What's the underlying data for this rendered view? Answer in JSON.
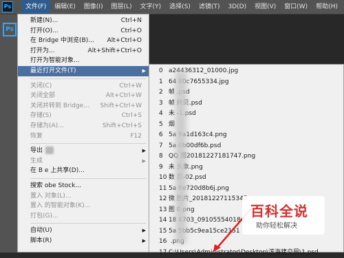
{
  "app": {
    "logo": "Ps"
  },
  "menubar": {
    "items": [
      "文件(F)",
      "编辑(E)",
      "图像(I)",
      "图层(L)",
      "文字(Y)",
      "选择(S)",
      "滤镜(T)",
      "3D(D)",
      "视图(V)",
      "窗口(W)",
      "帮助(H)"
    ]
  },
  "file_menu": {
    "new": "新建(N)...",
    "new_sc": "Ctrl+N",
    "open": "打开(O)...",
    "open_sc": "Ctrl+O",
    "bridge": "在 Bridge 中浏览(B)...",
    "bridge_sc": "Alt+Ctrl+O",
    "open_as": "打开为...",
    "open_as_sc": "Alt+Shift+Ctrl+O",
    "open_smart": "打开为智能对象...",
    "recent": "最近打开文件(T)",
    "close": "关闭(C)",
    "close_sc": "Ctrl+W",
    "close_all": "关闭全部",
    "close_all_sc": "Alt+Ctrl+W",
    "close_bridge": "关闭并转到 Bridge...",
    "close_bridge_sc": "Shift+Ctrl+W",
    "save": "存储(S)",
    "save_sc": "Ctrl+S",
    "save_as": "存储为(A)...",
    "save_as_sc": "Shift+Ctrl+S",
    "revert": "恢复",
    "revert_sc": "F12",
    "export": "导出",
    "generate": "生成",
    "share": "在 B          e 上共享(D)...",
    "search_stock": "搜索          obe Stock...",
    "place_embed": "置入          对象(L)...",
    "place_linked": "置入          的智能对象(K)...",
    "package": "打包(G)...",
    "automate": "自动(U)",
    "scripts": "脚本(R)"
  },
  "recent_files": [
    {
      "n": "0",
      "name": "a24436312_01000.jpg"
    },
    {
      "n": "1",
      "name": "64      80c7655334.jpg"
    },
    {
      "n": "2",
      "name": "帧      .psd"
    },
    {
      "n": "3",
      "name": "帧      拷贝.psd"
    },
    {
      "n": "4",
      "name": "未      -1.psd"
    },
    {
      "n": "5",
      "name": "烟      "
    },
    {
      "n": "6",
      "name": "5a      9a1d163c4.png"
    },
    {
      "n": "7",
      "name": "5a      0b00df6b.psd"
    },
    {
      "n": "8",
      "name": "QQ      图20181227181747.png"
    },
    {
      "n": "9",
      "name": "未      头象.png"
    },
    {
      "n": "10",
      "name": "数      页-02.psd"
    },
    {
      "n": "11",
      "name": "5a      8e720d8b6j.png"
    },
    {
      "n": "12",
      "name": "微      图片_20181227115347      "
    },
    {
      "n": "13",
      "name": "图      0.png"
    },
    {
      "n": "14",
      "name": "18      8703_09105554018      "
    },
    {
      "n": "15",
      "name": "5a      5bb5c9ea15ce2151      "
    },
    {
      "n": "16",
      "name": "      .png"
    },
    {
      "n": "17",
      "name": "C:\\Users\\Administrator\\Desktop\\滨海建交局\\1.psd"
    }
  ],
  "watermark": {
    "title": "百科全说",
    "subtitle": "助你轻松解决"
  },
  "side_text": "加"
}
